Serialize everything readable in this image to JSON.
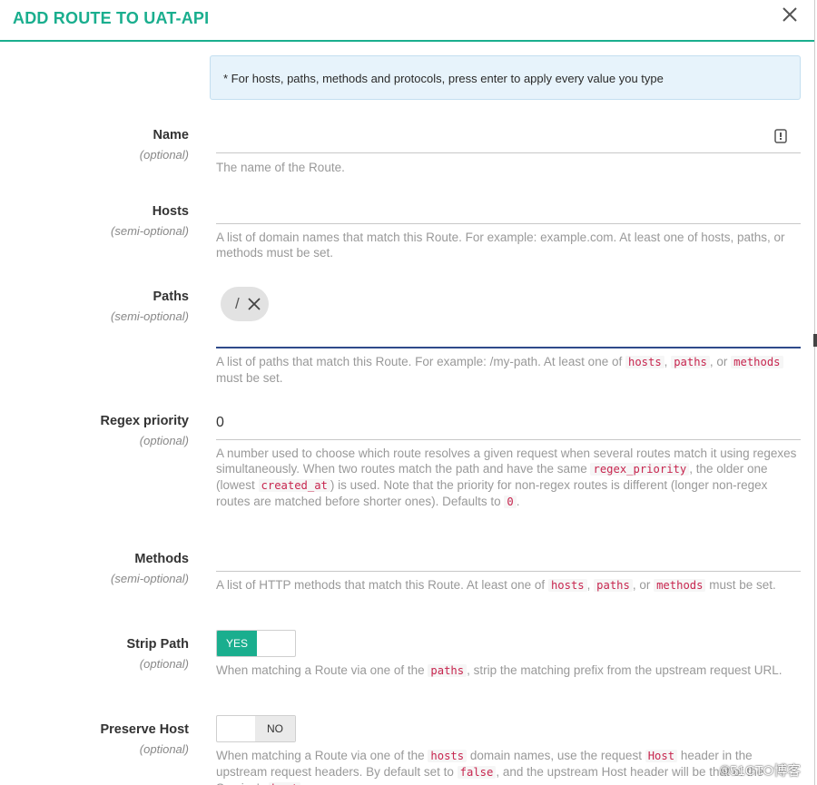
{
  "header": {
    "title": "ADD ROUTE TO UAT-API"
  },
  "notice": "* For hosts, paths, methods and protocols, press enter to apply every value you type",
  "fields": {
    "name": {
      "label": "Name",
      "sub": "(optional)",
      "value": "",
      "help": "The name of the Route."
    },
    "hosts": {
      "label": "Hosts",
      "sub": "(semi-optional)",
      "value": "",
      "help": "A list of domain names that match this Route. For example: example.com. At least one of hosts, paths, or methods must be set."
    },
    "paths": {
      "label": "Paths",
      "sub": "(semi-optional)",
      "chip": "/",
      "help": {
        "t1": "A list of paths that match this Route. For example: /my-path. At least one of ",
        "c1": "hosts",
        "t2": ", ",
        "c2": "paths",
        "t3": ", or ",
        "c3": "methods",
        "t4": " must be set."
      }
    },
    "regex_priority": {
      "label": "Regex priority",
      "sub": "(optional)",
      "value": "0",
      "help": {
        "t1": "A number used to choose which route resolves a given request when several routes match it using regexes simultaneously. When two routes match the path and have the same ",
        "c1": "regex_priority",
        "t2": ", the older one (lowest ",
        "c2": "created_at",
        "t3": ") is used. Note that the priority for non-regex routes is different (longer non-regex routes are matched before shorter ones). Defaults to ",
        "c3": "0",
        "t4": "."
      }
    },
    "methods": {
      "label": "Methods",
      "sub": "(semi-optional)",
      "value": "",
      "help": {
        "t1": "A list of HTTP methods that match this Route. At least one of ",
        "c1": "hosts",
        "t2": ", ",
        "c2": "paths",
        "t3": ", or ",
        "c3": "methods",
        "t4": " must be set."
      }
    },
    "strip_path": {
      "label": "Strip Path",
      "sub": "(optional)",
      "toggle": "YES",
      "help": {
        "t1": "When matching a Route via one of the ",
        "c1": "paths",
        "t2": ", strip the matching prefix from the upstream request URL."
      }
    },
    "preserve_host": {
      "label": "Preserve Host",
      "sub": "(optional)",
      "toggle": "NO",
      "help": {
        "t1": "When matching a Route via one of the ",
        "c1": "hosts",
        "t2": " domain names, use the request ",
        "c2": "Host",
        "t3": " header in the upstream request headers. By default set to ",
        "c3": "false",
        "t4": ", and the upstream Host header will be that of the Service's ",
        "c4": "host",
        "t5": "."
      }
    }
  },
  "watermark": "©51CTO博客",
  "colors": {
    "accent": "#1aae8e",
    "active_underline": "#2f4a8a",
    "code": "#c7254e",
    "notice_bg": "#e7f3fb"
  },
  "icons": {
    "close": "close-icon",
    "password": "password-manager-icon",
    "remove_chip": "remove-chip-icon"
  }
}
